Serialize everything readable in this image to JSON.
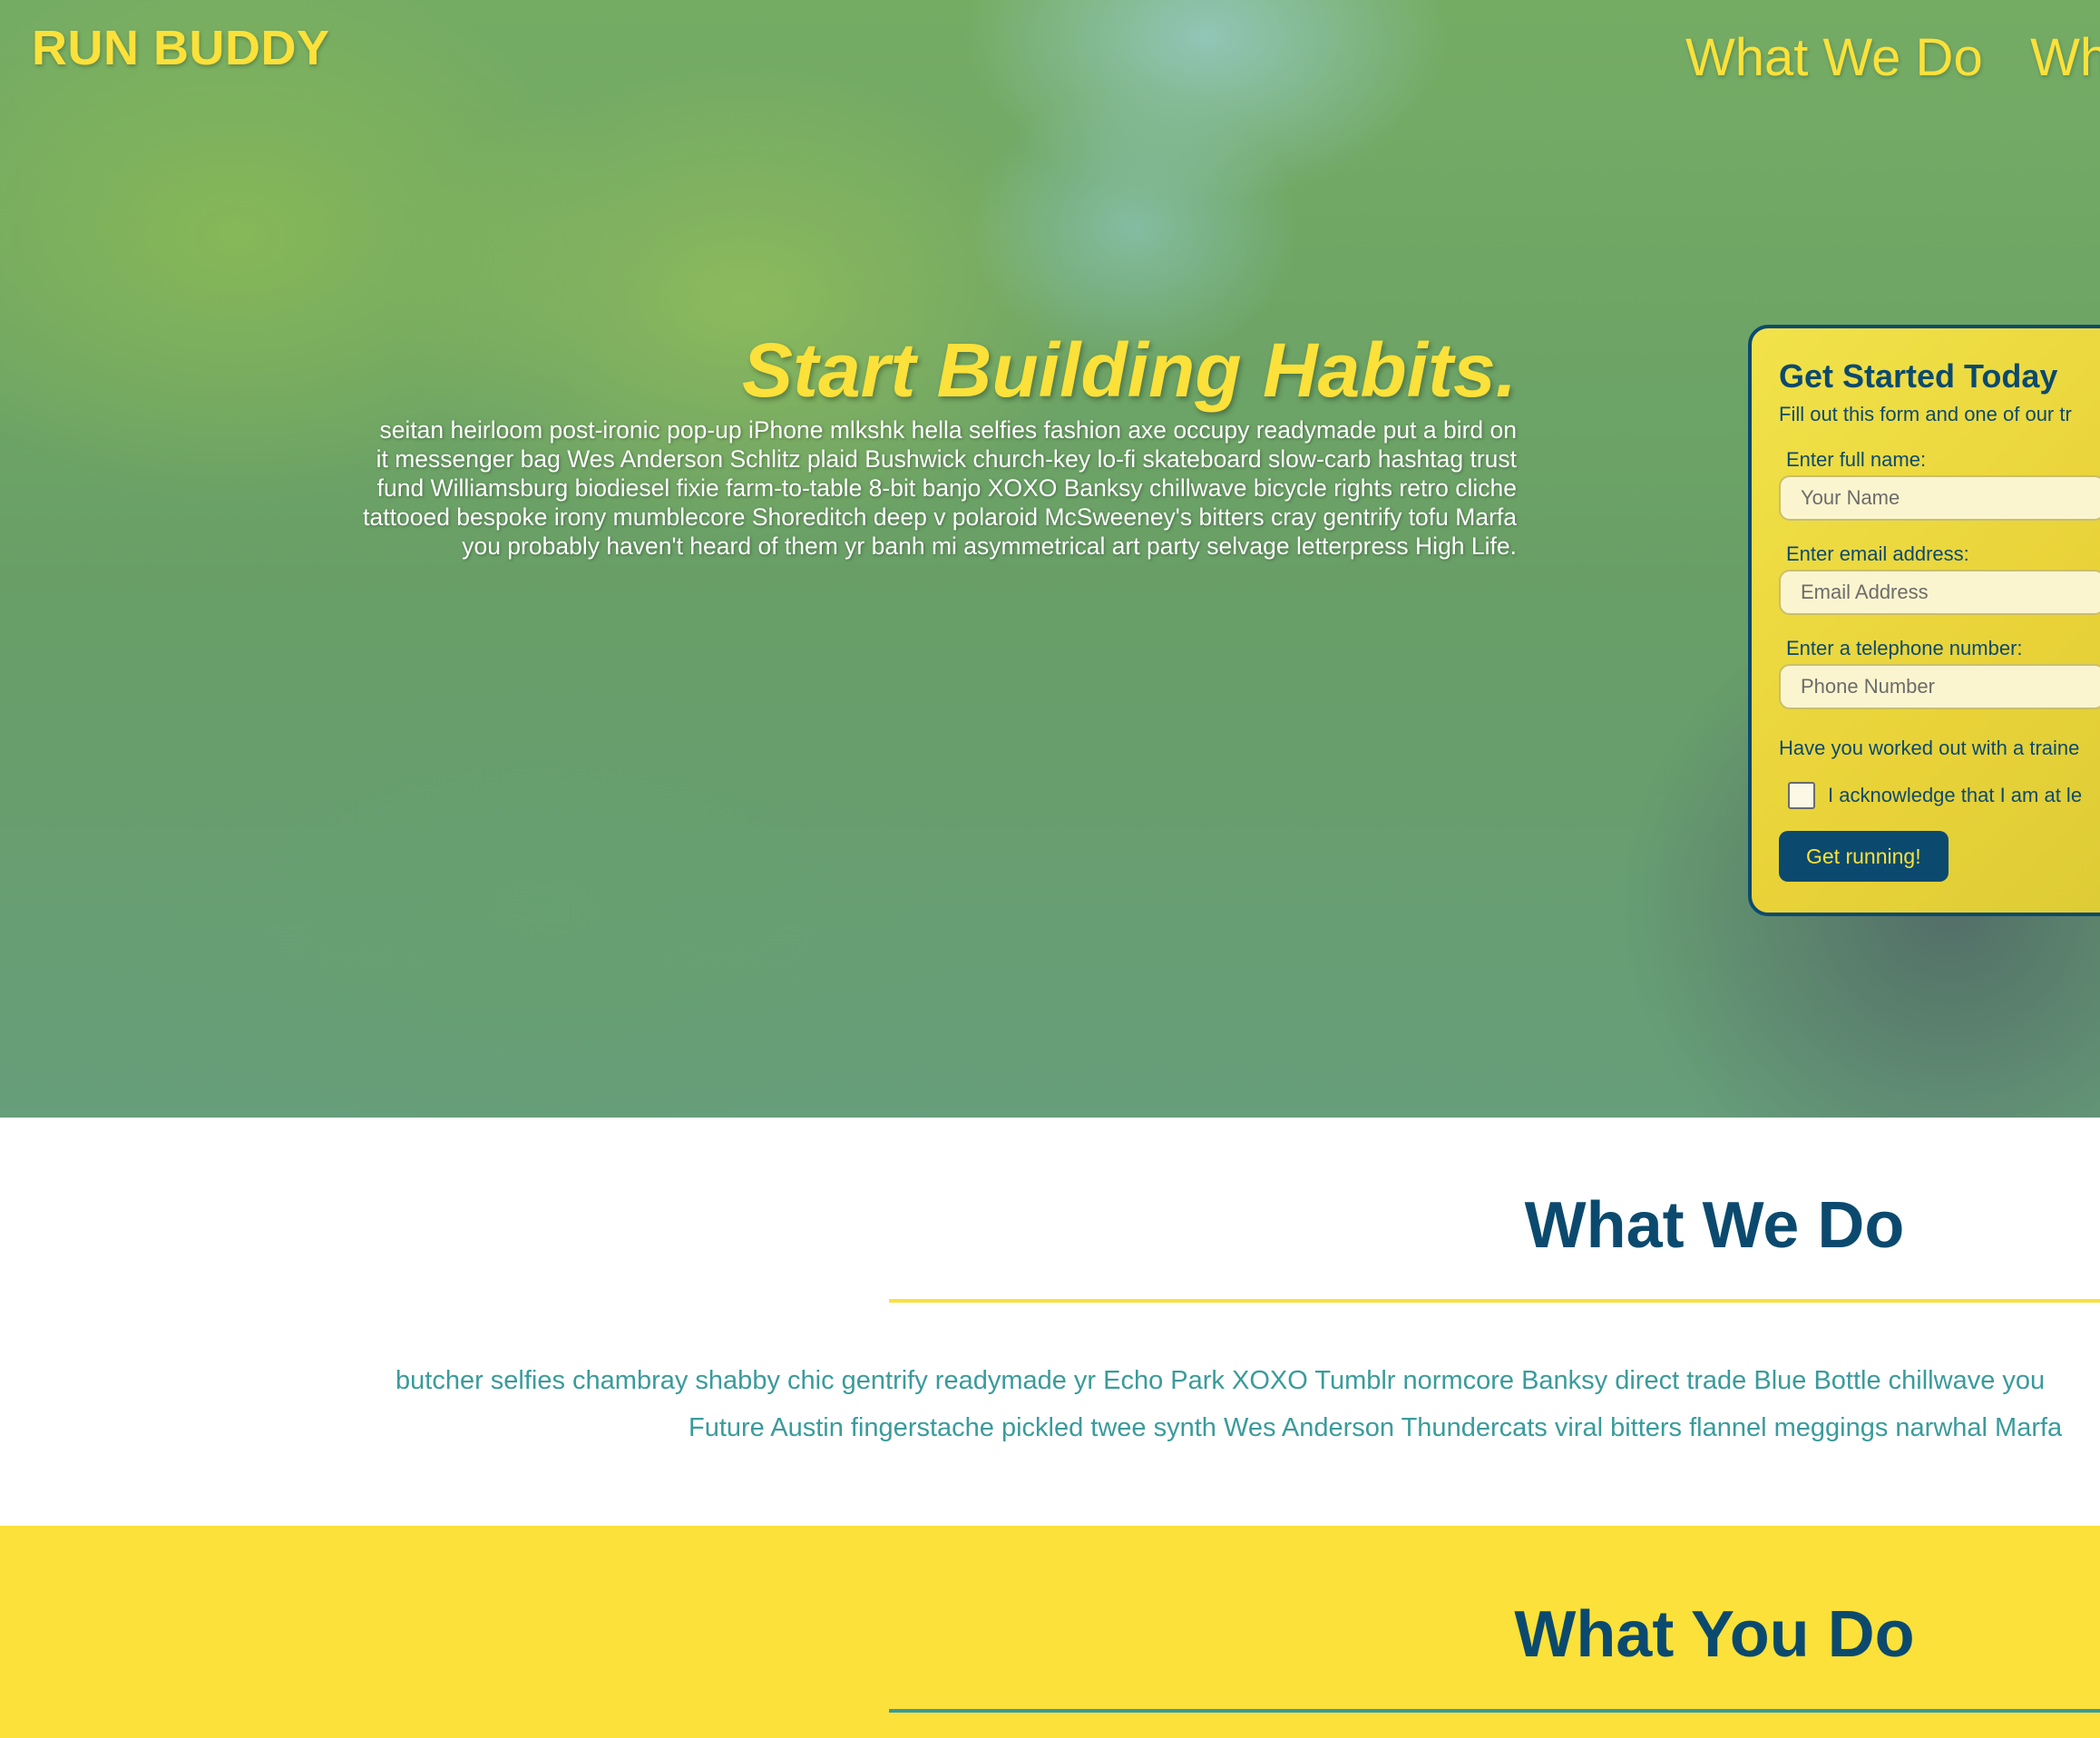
{
  "header": {
    "logo": "RUN BUDDY",
    "nav": [
      "What We Do",
      "What You Do"
    ]
  },
  "hero": {
    "title": "Start Building Habits.",
    "body": "seitan heirloom post-ironic pop-up iPhone mlkshk hella selfies fashion axe occupy readymade put a bird on it messenger bag Wes Anderson Schlitz plaid Bushwick church-key lo-fi skateboard slow-carb hashtag trust fund Williamsburg biodiesel fixie farm-to-table 8-bit banjo XOXO Banksy chillwave bicycle rights retro cliche tattooed bespoke irony mumblecore Shoreditch deep v polaroid McSweeney's bitters cray gentrify tofu Marfa you probably haven't heard of them yr banh mi asymmetrical art party selvage letterpress High Life."
  },
  "form": {
    "title": "Get Started Today",
    "subtitle": "Fill out this form and one of our tr",
    "name_label": "Enter full name:",
    "name_placeholder": "Your Name",
    "email_label": "Enter email address:",
    "email_placeholder": "Email Address",
    "phone_label": "Enter a telephone number:",
    "phone_placeholder": "Phone Number",
    "question": "Have you worked out with a traine",
    "acknowledge": "I acknowledge that I am at le",
    "submit": "Get running!"
  },
  "what_we_do": {
    "title": "What We Do",
    "line1": "butcher selfies chambray shabby chic gentrify readymade yr Echo Park XOXO Tumblr normcore Banksy direct trade Blue Bottle chillwave you",
    "line2": "Future Austin fingerstache pickled twee synth Wes Anderson Thundercats viral bitters flannel meggings narwhal Marfa"
  },
  "what_you_do": {
    "title": "What You Do"
  },
  "colors": {
    "brand_yellow": "#fbe13a",
    "brand_navy": "#0b4a6e",
    "accent_teal": "#3a9b9b"
  }
}
